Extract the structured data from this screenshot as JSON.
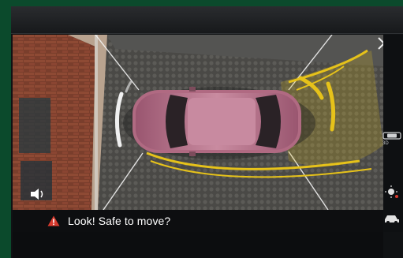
{
  "warning": {
    "text": "Look! Safe to move?",
    "icon": "warning-triangle-icon",
    "icon_color": "#d83a2e"
  },
  "camera_view": {
    "guide_color": "#e6c21a",
    "sensor_arc_color": "#e8e8e8",
    "car_color": "#b06a82"
  },
  "controls": {
    "close_icon": "close-icon",
    "view_mode_label": "3D",
    "view_mode_icon": "camera-view-icon",
    "night_mode_icon": "brightness-icon",
    "car_icon": "car-settings-icon",
    "audio_icon": "speaker-icon"
  }
}
